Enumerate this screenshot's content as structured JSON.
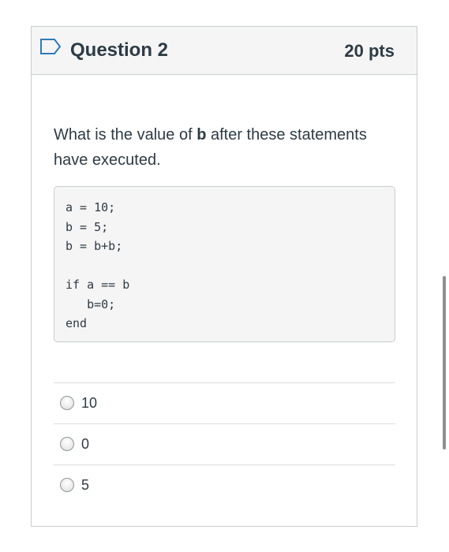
{
  "question": {
    "title": "Question 2",
    "points": "20 pts",
    "text_before": "What is the value of ",
    "text_bold": "b",
    "text_after": " after these statements have executed.",
    "code": "a = 10;\nb = 5;\nb = b+b;\n\nif a == b\n   b=0;\nend"
  },
  "answers": [
    {
      "label": "10"
    },
    {
      "label": "0"
    },
    {
      "label": "5"
    }
  ],
  "icons": {
    "flag": "bookmark-flag-icon",
    "radio": "radio-button-icon"
  },
  "colors": {
    "header_bg": "#f5f5f5",
    "text": "#2d3b45",
    "border": "#c7cdd1"
  }
}
